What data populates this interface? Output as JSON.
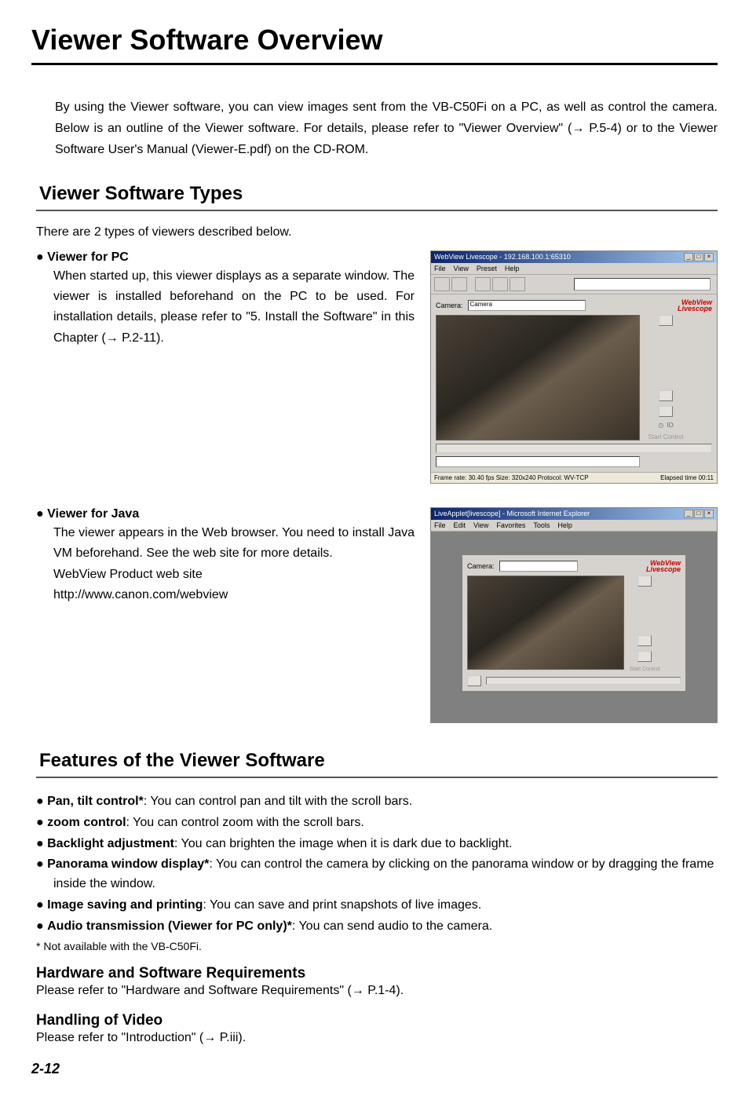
{
  "title": "Viewer Software Overview",
  "intro": "By using the Viewer software, you can view images sent from the VB-C50Fi on a PC, as well as control the camera. Below is an outline of the Viewer software. For details, please refer to \"Viewer Overview\" (→ P.5-4) or to the Viewer Software User's Manual (Viewer-E.pdf) on the CD-ROM.",
  "section1": {
    "heading": "Viewer Software Types",
    "intro": "There are 2 types of viewers described below.",
    "item1": {
      "title": "● Viewer for PC",
      "body": "When started up, this viewer displays as a separate window. The viewer is installed beforehand on the PC to be used. For installation details, please refer to \"5. Install the Software\" in this Chapter (→ P.2-11)."
    },
    "item2": {
      "title": "● Viewer for Java",
      "body1": "The viewer appears in the Web browser. You need to install Java VM beforehand. See the web site for more details.",
      "body2": "WebView Product web site",
      "body3": "http://www.canon.com/webview"
    }
  },
  "section2": {
    "heading": "Features of the Viewer Software",
    "features": [
      {
        "label": "Pan, tilt control*",
        "desc": ": You can control pan and tilt with the scroll bars."
      },
      {
        "label": "zoom control",
        "desc": ": You can control zoom with the scroll bars."
      },
      {
        "label": "Backlight adjustment",
        "desc": ": You can brighten the image when it is dark due to backlight."
      },
      {
        "label": "Panorama window display*",
        "desc": ": You can control the camera by clicking on the panorama window or by dragging the frame inside the window."
      },
      {
        "label": "Image saving and printing",
        "desc": ": You can save and print snapshots of live images."
      },
      {
        "label": "Audio transmission (Viewer for PC only)*",
        "desc": ": You can send audio to the camera."
      }
    ],
    "note": "* Not available with the VB-C50Fi.",
    "sub1": {
      "title": "Hardware and Software Requirements",
      "body": "Please refer to \"Hardware and Software Requirements\" (→ P.1-4)."
    },
    "sub2": {
      "title": "Handling of Video",
      "body": "Please refer to \"Introduction\" (→ P.iii)."
    }
  },
  "page_number": "2-12",
  "screenshot1": {
    "title": "WebView Livescope - 192.168.100.1:65310",
    "menus": [
      "File",
      "View",
      "Preset",
      "Help"
    ],
    "camera_label": "Camera:",
    "camera_value": "Camera",
    "logo_line1": "WebView",
    "logo_line2": "Livescope",
    "status_left": "Frame rate: 30.40 fps   Size: 320x240   Protocol: WV-TCP",
    "status_right": "Elapsed time 00:11",
    "start_control": "Start Control",
    "io": "IO"
  },
  "screenshot2": {
    "title": "LiveApplet[livescope] - Microsoft Internet Explorer",
    "menus": [
      "File",
      "Edit",
      "View",
      "Favorites",
      "Tools",
      "Help"
    ],
    "camera_label": "Camera:",
    "logo_line1": "WebView",
    "logo_line2": "Livescope",
    "start_control": "Start Control"
  }
}
